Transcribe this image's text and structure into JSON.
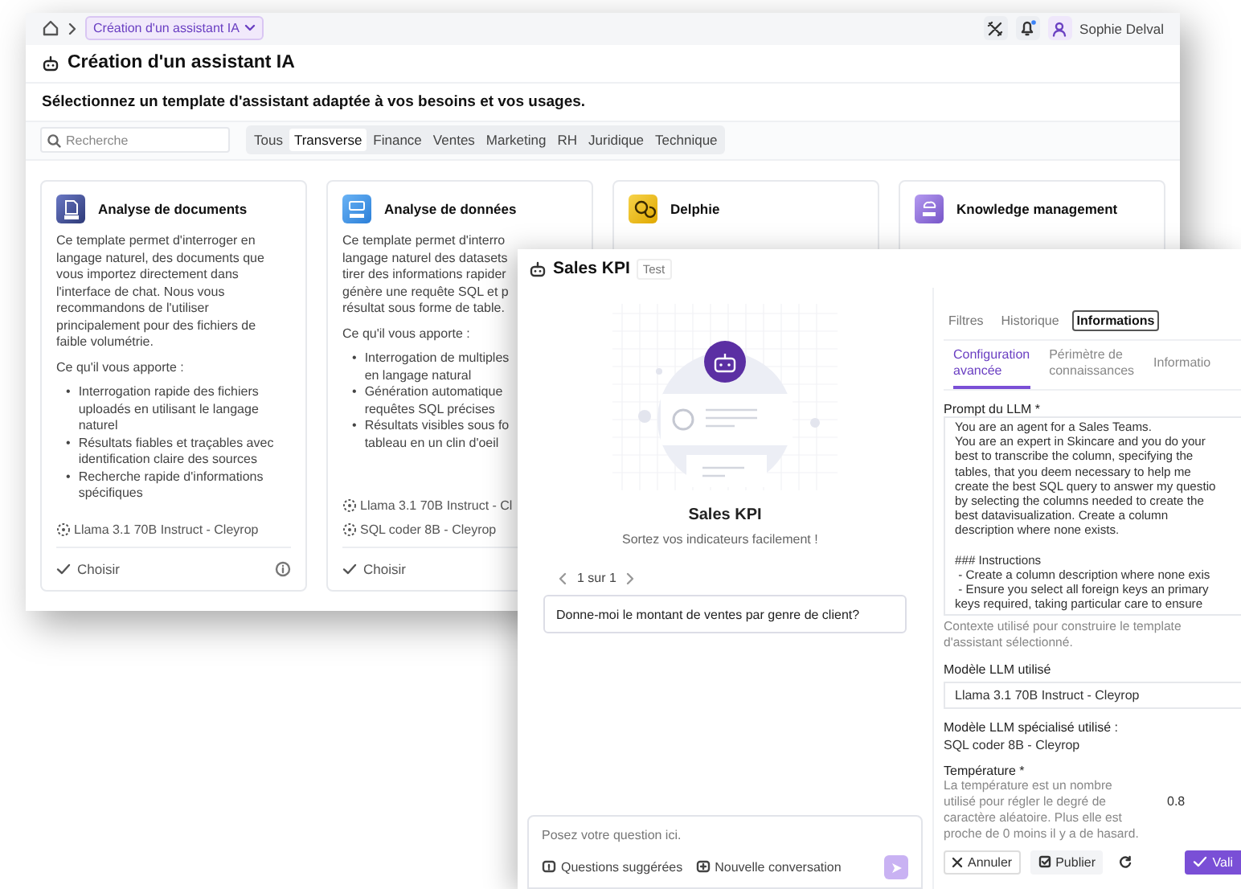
{
  "topbar": {
    "breadcrumb": "Création d'un assistant IA",
    "user": "Sophie Delval"
  },
  "page": {
    "title": "Création d'un assistant IA",
    "subtitle": "Sélectionnez un template d'assistant adaptée à vos besoins et vos usages."
  },
  "search": {
    "placeholder": "Recherche"
  },
  "filters": [
    {
      "label": "Tous",
      "selected": false
    },
    {
      "label": "Transverse",
      "selected": true
    },
    {
      "label": "Finance",
      "selected": false
    },
    {
      "label": "Ventes",
      "selected": false
    },
    {
      "label": "Marketing",
      "selected": false
    },
    {
      "label": "RH",
      "selected": false
    },
    {
      "label": "Juridique",
      "selected": false
    },
    {
      "label": "Technique",
      "selected": false
    }
  ],
  "cards": [
    {
      "kind": "doc",
      "bullet": "•",
      "title": "Analyse de documents",
      "description": "Ce template permet d'interroger en\nlangage naturel, des documents que\nvous importez directement dans\nl'interface de chat. Nous vous\nrecommandons de l'utiliser\nprincipalement pour des fichiers de\nfaible volumétrie.",
      "benefits_label": "Ce qu'il vous apporte :",
      "benefits": [
        "Interrogation rapide des fichiers\nuploadés en utilisant le langage\nnaturel",
        "Résultats fiables et traçables avec\nidentification claire des sources",
        "Recherche rapide d'informations\nspécifiques"
      ],
      "models": [
        "Llama 3.1 70B Instruct - Cleyrop"
      ],
      "action": "Choisir",
      "info": true
    },
    {
      "kind": "sql",
      "bullet": "•",
      "title": "Analyse de données",
      "description": "Ce template permet d'interro\nlangage naturel des datasets\ntirer des informations rapider\ngénère une requête SQL et p\nrésultat sous forme de table.",
      "benefits_label": "Ce qu'il vous apporte :",
      "benefits": [
        "Interrogation de multiples\nen langage natural",
        "Génération automatique\nrequêtes SQL précises",
        "Résultats visibles sous fo\ntableau en un clin d'oeil"
      ],
      "models": [
        "Llama 3.1 70B Instruct - Cl",
        "SQL coder 8B - Cleyrop"
      ],
      "action": "Choisir",
      "info": false
    },
    {
      "kind": "chat",
      "title": "Delphie"
    },
    {
      "kind": "rag",
      "title": "Knowledge management"
    }
  ],
  "assistant": {
    "title": "Sales KPI",
    "badge": "Test",
    "name": "Sales KPI",
    "tagline": "Sortez vos indicateurs facilement !",
    "pager": "1 sur 1",
    "question": "Donne-moi le montant de ventes par genre de client?"
  },
  "composer": {
    "placeholder": "Posez votre question ici.",
    "buttons": [
      {
        "kind": "suggest",
        "label": "Questions suggérées"
      },
      {
        "kind": "new",
        "label": "Nouvelle conversation"
      }
    ]
  },
  "panel_tabs": [
    {
      "label": "Filtres",
      "selected": false
    },
    {
      "label": "Historique",
      "selected": false
    },
    {
      "label": "Informations",
      "selected": true
    }
  ],
  "sub_tabs": [
    {
      "label": "Configuration\navancée",
      "selected": true
    },
    {
      "label": "Périmètre de\nconnaissances",
      "selected": false
    },
    {
      "label": "Informatio",
      "selected": false
    }
  ],
  "prompt": {
    "label": "Prompt du LLM *",
    "paragraphs": [
      [
        "You are an agent for a Sales Teams.",
        "You are an expert in Skincare and you do your",
        "best to transcribe the column, specifying the",
        "tables, that you deem necessary to help me",
        "create the best SQL query to answer my questio",
        "by selecting the columns needed to create the",
        "best datavisualization. Create a column",
        "description where none exists."
      ],
      [
        "### Instructions",
        " - Create a column description where none exis",
        " - Ensure you select all foreign keys an primary",
        "keys required, taking particular care to ensure"
      ]
    ],
    "hint": "Contexte utilisé pour construire le template d'assistant sélectionné."
  },
  "llm": {
    "label": "Modèle LLM utilisé",
    "value": "Llama 3.1 70B Instruct - Cleyrop"
  },
  "specialized": {
    "label": "Modèle LLM spécialisé utilisé :",
    "value": "SQL coder 8B - Cleyrop"
  },
  "temperature": {
    "label": "Température *",
    "description": "La température est un nombre utilisé pour régler le degré de caractère aléatoire. Plus elle est proche de 0 moins il y a de hasard.",
    "value": "0.8"
  },
  "actions": [
    {
      "kind": "cancel",
      "label": "Annuler"
    },
    {
      "kind": "publish",
      "label": "Publier"
    },
    {
      "kind": "refresh"
    },
    {
      "kind": "validate",
      "label": "Vali"
    }
  ]
}
